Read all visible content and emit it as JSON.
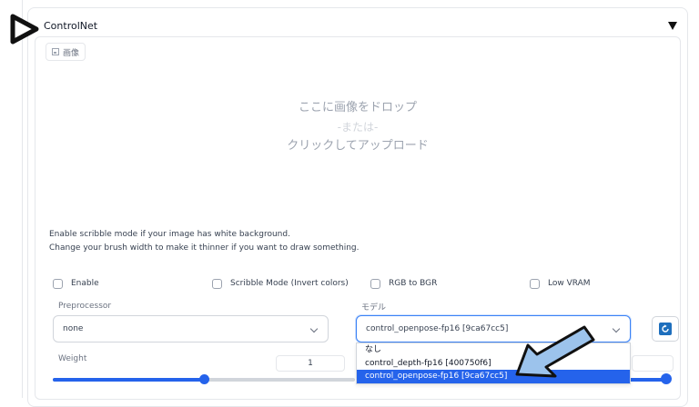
{
  "panel": {
    "title": "ControlNet",
    "image_tab_label": "画像"
  },
  "dropzone": {
    "line1": "ここに画像をドロップ",
    "line2": "-または-",
    "line3": "クリックしてアップロード"
  },
  "hints": {
    "line1": "Enable scribble mode if your image has white background.",
    "line2": "Change your brush width to make it thinner if you want to draw something."
  },
  "checkboxes": [
    {
      "label": "Enable",
      "checked": false
    },
    {
      "label": "Scribble Mode (Invert colors)",
      "checked": false
    },
    {
      "label": "RGB to BGR",
      "checked": false
    },
    {
      "label": "Low VRAM",
      "checked": false
    }
  ],
  "preprocessor": {
    "label": "Preprocessor",
    "value": "none"
  },
  "model": {
    "label": "モデル",
    "value": "control_openpose-fp16 [9ca67cc5]",
    "options": [
      "なし",
      "control_depth-fp16 [400750f6]",
      "control_openpose-fp16 [9ca67cc5]"
    ],
    "selected_index": 2
  },
  "weight": {
    "label": "Weight",
    "value": "1",
    "slider_fraction": 0.5
  },
  "colors": {
    "accent": "#2563eb",
    "refresh_button": "#1e6fbd",
    "annotation_arrow": "#9cc3ec"
  }
}
